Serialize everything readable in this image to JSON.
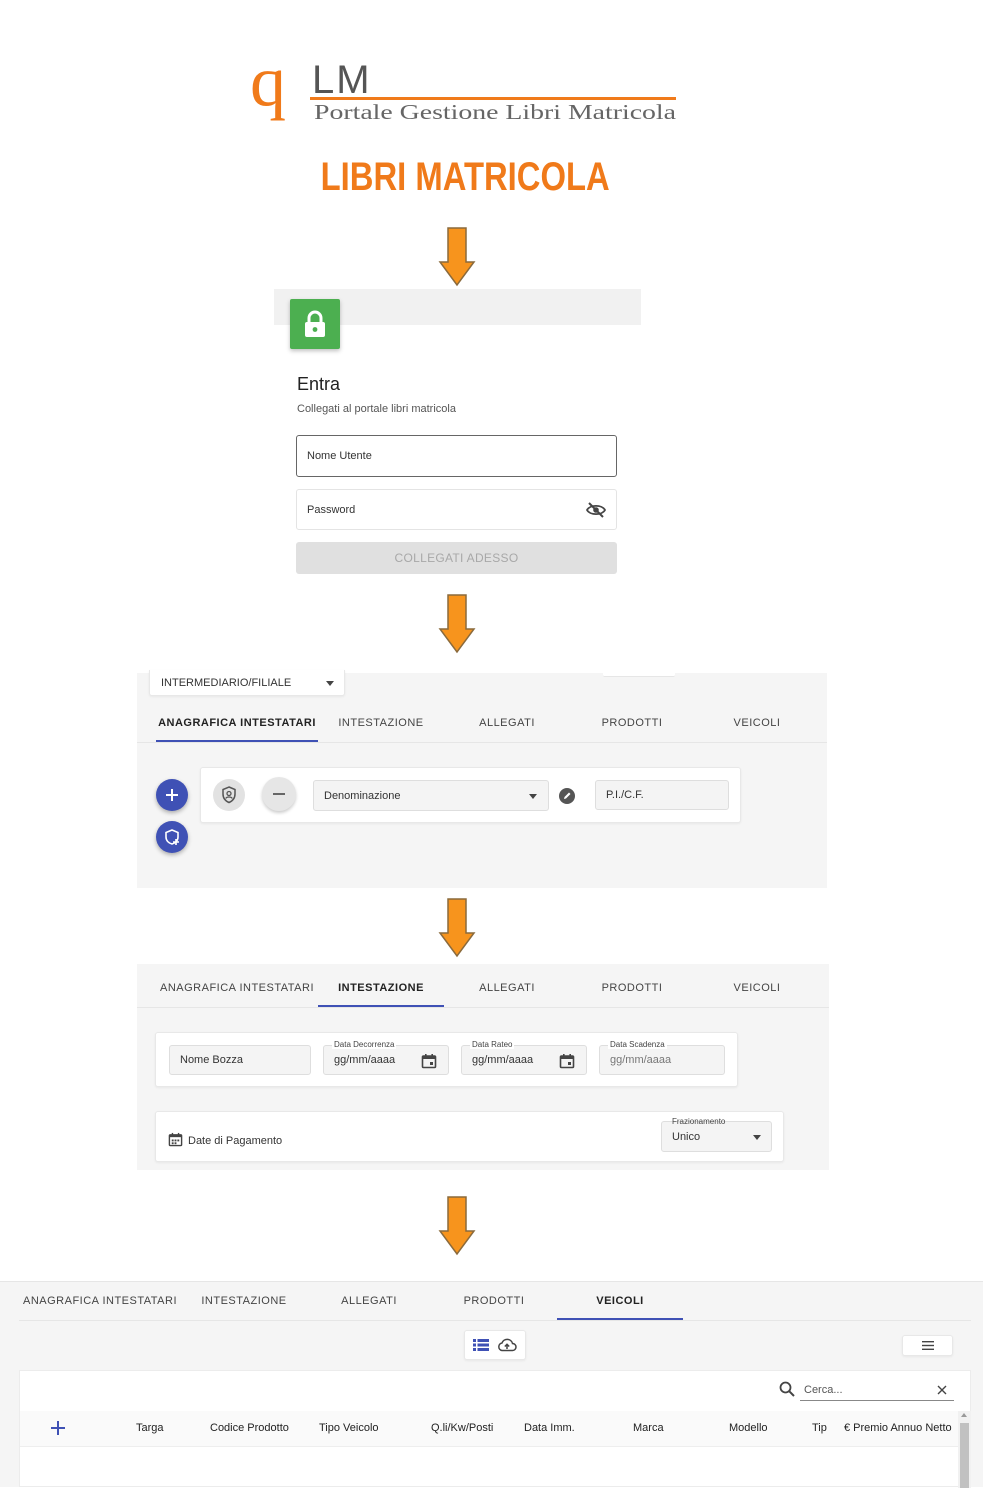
{
  "logo": {
    "mark": "q",
    "letters": "LM",
    "tagline": "Portale Gestione Libri Matricola"
  },
  "heading": "LIBRI MATRICOLA",
  "colors": {
    "brand_orange": "#f07a1a",
    "arrow_orange": "#f7941d",
    "accent_blue": "#3f51b5",
    "lock_green": "#4caf50"
  },
  "login": {
    "title": "Entra",
    "subtitle": "Collegati al portale libri matricola",
    "username_placeholder": "Nome Utente",
    "password_placeholder": "Password",
    "submit_label": "COLLEGATI ADESSO"
  },
  "tabs": [
    "ANAGRAFICA INTESTATARI",
    "INTESTAZIONE",
    "ALLEGATI",
    "PRODOTTI",
    "VEICOLI"
  ],
  "anagrafica": {
    "intermediario_label": "INTERMEDIARIO/FILIALE",
    "denominazione_label": "Denominazione",
    "pi_cf_placeholder": "P.I./C.F."
  },
  "intestazione": {
    "nome_bozza_placeholder": "Nome Bozza",
    "data_decorrenza_label": "Data Decorrenza",
    "data_rateo_label": "Data Rateo",
    "data_scadenza_label": "Data Scadenza",
    "date_placeholder": "gg/mm/aaaa",
    "date_pagamento_label": "Date di Pagamento",
    "frazionamento_label": "Frazionamento",
    "frazionamento_value": "Unico"
  },
  "veicoli": {
    "search_placeholder": "Cerca...",
    "columns": [
      "Targa",
      "Codice Prodotto",
      "Tipo Veicolo",
      "Q.li/Kw/Posti",
      "Data Imm.",
      "Marca",
      "Modello",
      "Tip",
      "€ Premio Annuo Netto"
    ]
  }
}
